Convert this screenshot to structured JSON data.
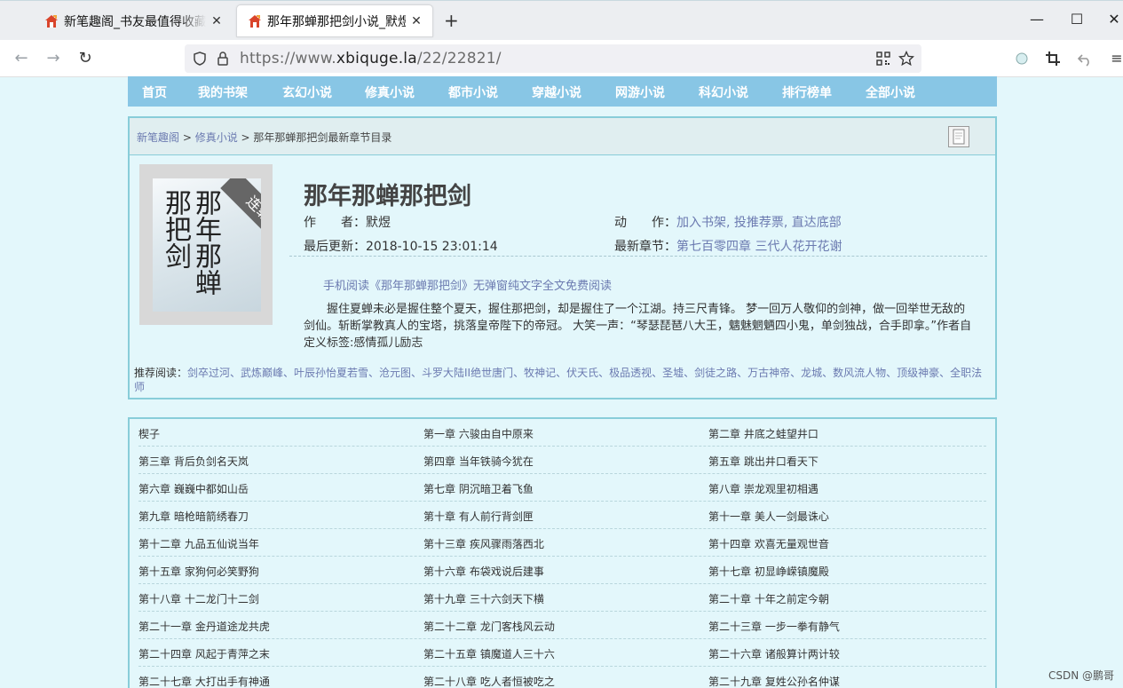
{
  "browser": {
    "tabs": [
      {
        "title": "新笔趣阁_书友最值得收藏的网络小说阅读网",
        "active": false
      },
      {
        "title": "那年那蝉那把剑小说_默煜_",
        "active": true
      }
    ],
    "new_tab": "+",
    "controls": {
      "minimize": "—",
      "maximize": "☐",
      "close": "✕"
    },
    "url_prefix": "https://www.",
    "url_domain": "xbiquge.la",
    "url_path": "/22/22821/"
  },
  "site_nav": [
    "首页",
    "我的书架",
    "玄幻小说",
    "修真小说",
    "都市小说",
    "穿越小说",
    "网游小说",
    "科幻小说",
    "排行榜单",
    "全部小说"
  ],
  "breadcrumb": {
    "home": "新笔趣阁",
    "sep1": " > ",
    "category": "修真小说",
    "sep2": " > ",
    "current": "那年那蝉那把剑最新章节目录"
  },
  "book": {
    "cover_title": "那年那蝉那把剑",
    "cover_ribbon": "连载中",
    "title": "那年那蝉那把剑",
    "author_label": "作　　者：",
    "author": "默煜",
    "action_label": "动　　作：",
    "actions": "加入书架, 投推荐票, 直达底部",
    "updated_label": "最后更新：",
    "updated": "2018-10-15 23:01:14",
    "latest_label": "最新章节：",
    "latest": "第七百零四章 三代人花开花谢",
    "promo": "手机阅读《那年那蝉那把剑》无弹窗纯文字全文免费阅读",
    "description": "握住夏蝉未必是握住整个夏天，握住那把剑，却是握住了一个江湖。持三尺青锋。 梦一回万人敬仰的剑神，做一回举世无敌的剑仙。斩断掌教真人的宝塔，挑落皇帝陛下的帝冠。 大笑一声：“琴瑟琵琶八大王，魑魅魍魉四小鬼，单剑独战，合手即拿。”作者自定义标签:感情孤儿励志",
    "recommend_label": "推荐阅读：",
    "recommend": "剑卒过河、武炼巅峰、叶辰孙怡夏若雪、沧元图、斗罗大陆II绝世唐门、牧神记、伏天氏、极品透视、圣墟、剑徒之路、万古神帝、龙城、数风流人物、顶级神豪、全职法师"
  },
  "chapters": [
    [
      "楔子",
      "第一章 六骏由自中原来",
      "第二章 井底之蛙望井口"
    ],
    [
      "第三章 背后负剑名天岚",
      "第四章 当年铁骑今犹在",
      "第五章 跳出井口看天下"
    ],
    [
      "第六章 巍巍中都如山岳",
      "第七章 阴沉暗卫着飞鱼",
      "第八章 崇龙观里初相遇"
    ],
    [
      "第九章 暗枪暗箭绣春刀",
      "第十章 有人前行背剑匣",
      "第十一章 美人一剑最诛心"
    ],
    [
      "第十二章 九品五仙说当年",
      "第十三章 疾风骤雨落西北",
      "第十四章 欢喜无量观世音"
    ],
    [
      "第十五章 家狗何必笑野狗",
      "第十六章 布袋戏说后建事",
      "第十七章 初显峥嵘镇魔殿"
    ],
    [
      "第十八章 十二龙门十二剑",
      "第十九章 三十六剑天下横",
      "第二十章 十年之前定今朝"
    ],
    [
      "第二十一章 金丹道途龙共虎",
      "第二十二章 龙门客栈风云动",
      "第二十三章 一步一拳有静气"
    ],
    [
      "第二十四章 风起于青萍之末",
      "第二十五章 镇魔道人三十六",
      "第二十六章 诸般算计两计较"
    ],
    [
      "第二十七章 大打出手有神通",
      "第二十八章 吃人者恒被吃之",
      "第二十九章 复姓公孙名仲谋"
    ]
  ],
  "watermark": "CSDN @鹏哥"
}
